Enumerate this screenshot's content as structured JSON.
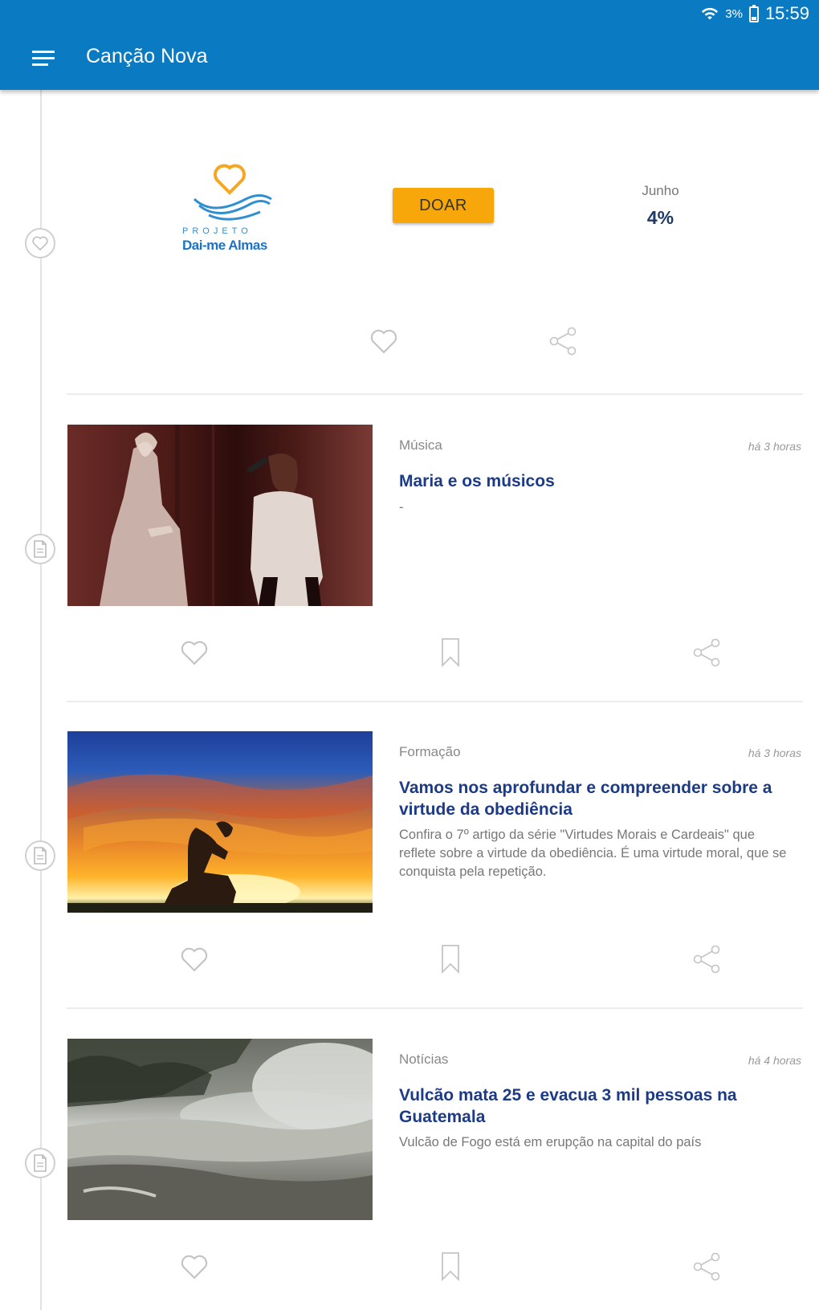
{
  "status_bar": {
    "battery": "3%",
    "time": "15:59"
  },
  "app_bar": {
    "title": "Canção Nova",
    "menu_icon": "hamburger-menu-icon"
  },
  "donation": {
    "logo_top": "PROJETO",
    "logo_bottom": "Dai-me Almas",
    "button_label": "DOAR",
    "month": "Junho",
    "percent": "4%",
    "timeline_icon": "heart-icon"
  },
  "articles": [
    {
      "category": "Música",
      "time": "há 3 horas",
      "title": "Maria e os músicos",
      "description": "-",
      "image": "photo-singer-and-mary-statue",
      "timeline_icon": "document-icon"
    },
    {
      "category": "Formação",
      "time": "há 3 horas",
      "title": "Vamos nos aprofundar e compreender sobre a virtude da obediência",
      "description": "Confira o 7º artigo da série \"Virtudes Morais e Cardeais\" que reflete sobre a virtude da obediência. É uma virtude moral, que se conquista pela repetição.",
      "image": "photo-man-praying-sunset",
      "timeline_icon": "document-icon"
    },
    {
      "category": "Notícias",
      "time": "há 4 horas",
      "title": "Vulcão mata 25 e evacua 3 mil pessoas na Guatemala",
      "description": "Vulcão de Fogo está em erupção na capital do país",
      "image": "photo-volcano-ash-road",
      "timeline_icon": "document-icon"
    }
  ],
  "icons": {
    "like": "heart-outline-icon",
    "bookmark": "bookmark-icon",
    "share": "share-icon"
  },
  "colors": {
    "primary": "#0a7bc2",
    "accent": "#f7a70a",
    "title": "#1c3a86"
  }
}
